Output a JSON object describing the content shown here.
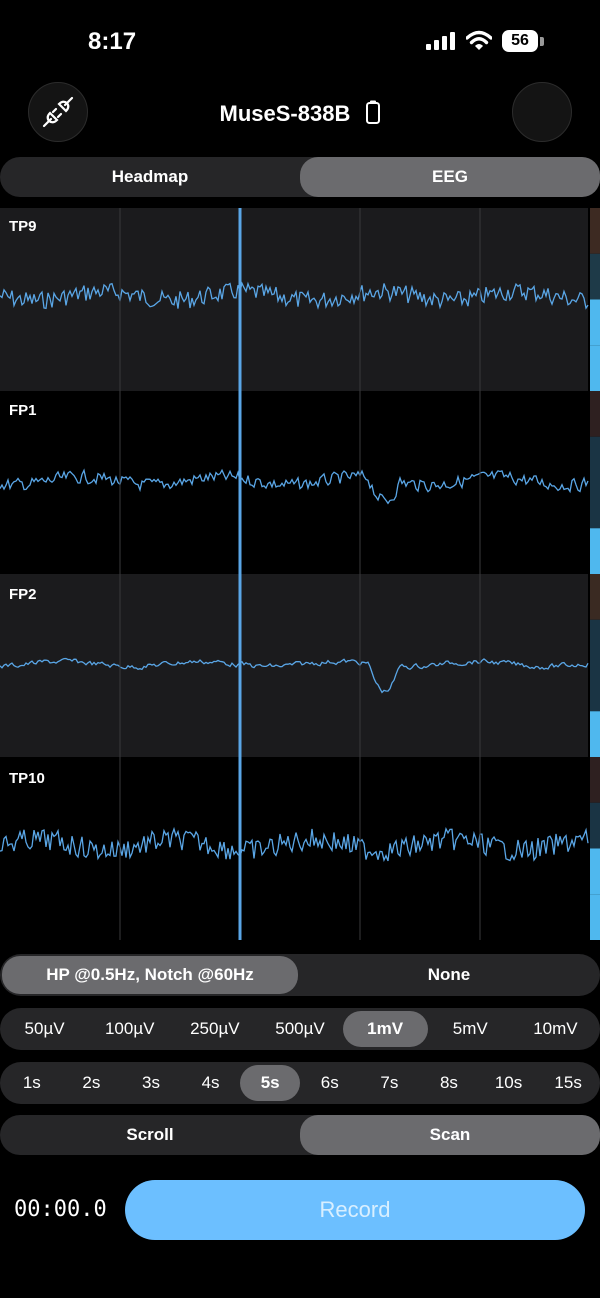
{
  "status_bar": {
    "time": "8:17",
    "battery_level": "56"
  },
  "header": {
    "device_name": "MuseS-838B"
  },
  "view_tabs": [
    {
      "label": "Headmap",
      "selected": false
    },
    {
      "label": "EEG",
      "selected": true
    }
  ],
  "channels": [
    {
      "label": "TP9"
    },
    {
      "label": "FP1"
    },
    {
      "label": "FP2"
    },
    {
      "label": "TP10"
    }
  ],
  "filter_options": [
    {
      "label": "HP @0.5Hz, Notch @60Hz",
      "selected": true
    },
    {
      "label": "None",
      "selected": false
    }
  ],
  "scale_options": [
    {
      "label": "50µV",
      "selected": false
    },
    {
      "label": "100µV",
      "selected": false
    },
    {
      "label": "250µV",
      "selected": false
    },
    {
      "label": "500µV",
      "selected": false
    },
    {
      "label": "1mV",
      "selected": true
    },
    {
      "label": "5mV",
      "selected": false
    },
    {
      "label": "10mV",
      "selected": false
    }
  ],
  "time_options": [
    {
      "label": "1s",
      "selected": false
    },
    {
      "label": "2s",
      "selected": false
    },
    {
      "label": "3s",
      "selected": false
    },
    {
      "label": "4s",
      "selected": false
    },
    {
      "label": "5s",
      "selected": true
    },
    {
      "label": "6s",
      "selected": false
    },
    {
      "label": "7s",
      "selected": false
    },
    {
      "label": "8s",
      "selected": false
    },
    {
      "label": "10s",
      "selected": false
    },
    {
      "label": "15s",
      "selected": false
    }
  ],
  "mode_options": [
    {
      "label": "Scroll",
      "selected": false
    },
    {
      "label": "Scan",
      "selected": true
    }
  ],
  "recording": {
    "timer": "00:00.0",
    "button_label": "Record"
  },
  "colors": {
    "trace": "#5aa6e6",
    "cursor": "#5aa6e6",
    "accent": "#6cbfff"
  }
}
